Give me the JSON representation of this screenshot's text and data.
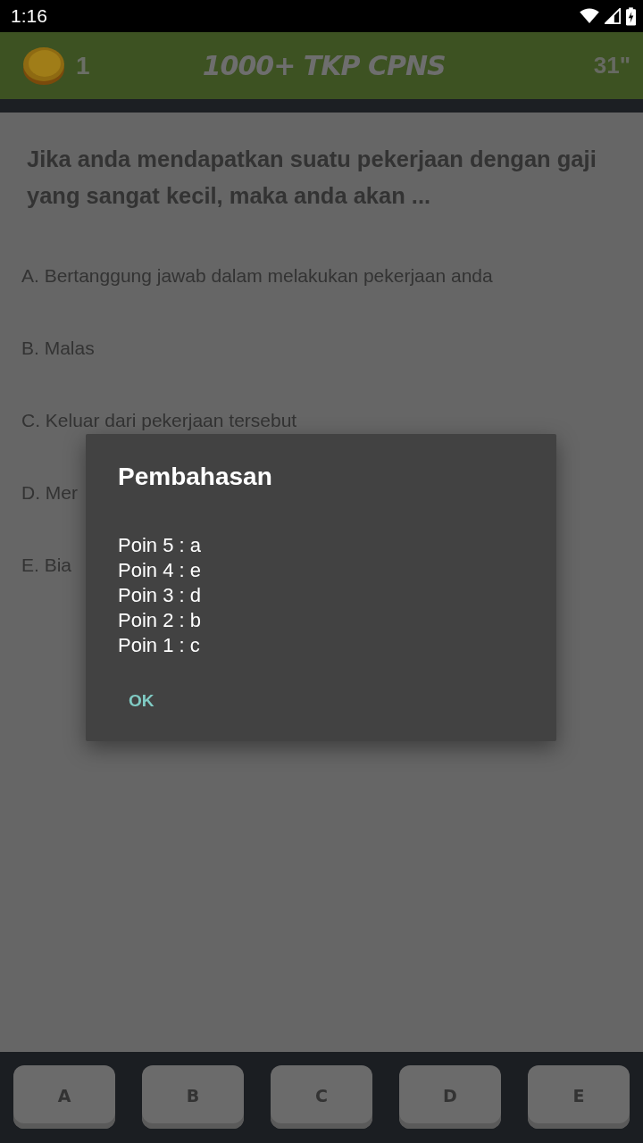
{
  "status_bar": {
    "time": "1:16"
  },
  "app_bar": {
    "coins": "1",
    "title": "1000+ TKP CPNS",
    "timer": "31\""
  },
  "question": {
    "text": "Jika anda mendapatkan suatu pekerjaan dengan gaji yang sangat kecil, maka anda akan ...",
    "options": [
      "A. Bertanggung jawab dalam melakukan pekerjaan anda",
      "B. Malas",
      "C. Keluar dari pekerjaan tersebut",
      "D. Mer",
      "E. Bia"
    ]
  },
  "dialog": {
    "title": "Pembahasan",
    "lines": [
      "Poin 5 : a",
      "Poin 4 : e",
      "Poin 3 : d",
      "Poin 2 : b",
      "Poin 1 : c"
    ],
    "button": "OK"
  },
  "answer_buttons": [
    "A",
    "B",
    "C",
    "D",
    "E"
  ]
}
